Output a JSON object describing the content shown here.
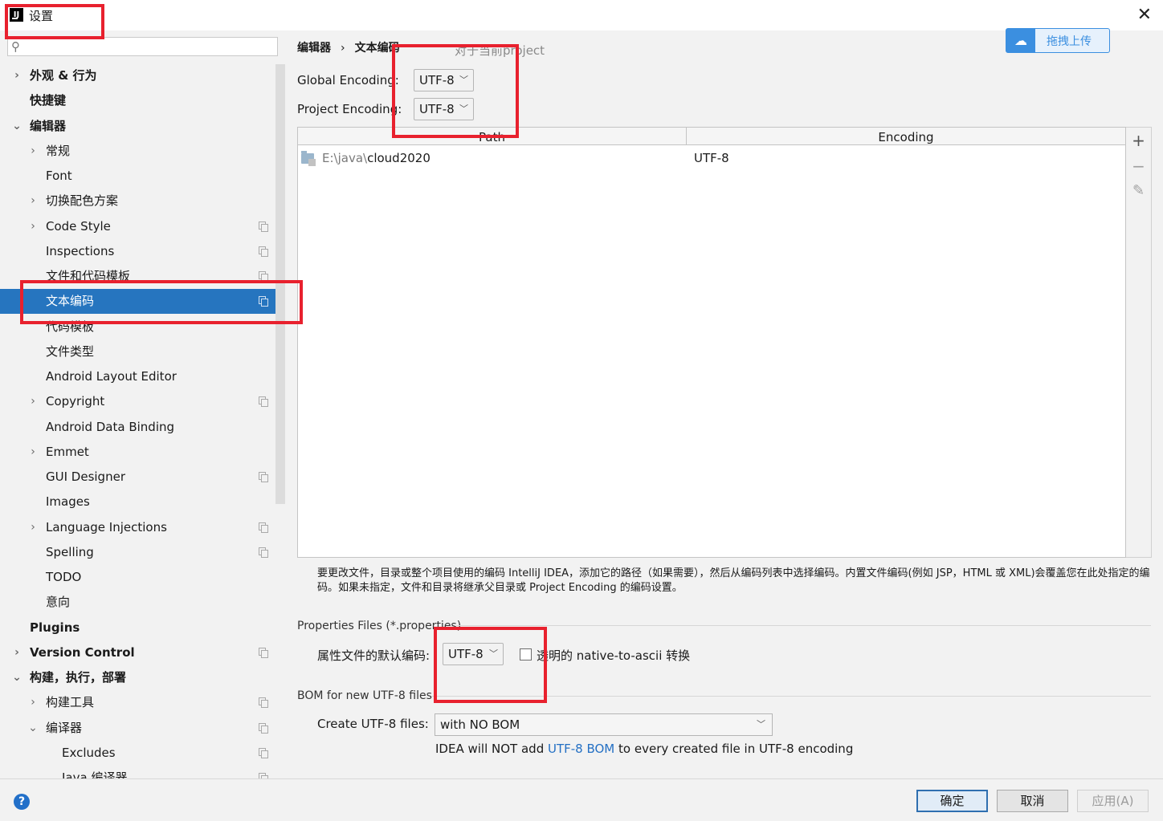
{
  "window": {
    "title": "设置",
    "app_icon": "intellij-idea-icon"
  },
  "sidebar": {
    "search_placeholder": "",
    "items": [
      {
        "label": "外观 & 行为",
        "bold": true,
        "chevron": "right",
        "copy": false
      },
      {
        "label": "快捷键",
        "bold": true,
        "chevron": "",
        "copy": false
      },
      {
        "label": "编辑器",
        "bold": true,
        "chevron": "down",
        "copy": false
      },
      {
        "label": "常规",
        "bold": false,
        "chevron": "right",
        "copy": false
      },
      {
        "label": "Font",
        "bold": false,
        "chevron": "",
        "copy": false
      },
      {
        "label": "切换配色方案",
        "bold": false,
        "chevron": "right",
        "copy": false
      },
      {
        "label": "Code Style",
        "bold": false,
        "chevron": "right",
        "copy": true
      },
      {
        "label": "Inspections",
        "bold": false,
        "chevron": "",
        "copy": true
      },
      {
        "label": "文件和代码模板",
        "bold": false,
        "chevron": "",
        "copy": true
      },
      {
        "label": "文本编码",
        "bold": false,
        "chevron": "",
        "copy": true,
        "selected": true
      },
      {
        "label": "代码模板",
        "bold": false,
        "chevron": "",
        "copy": false
      },
      {
        "label": "文件类型",
        "bold": false,
        "chevron": "",
        "copy": false
      },
      {
        "label": "Android Layout Editor",
        "bold": false,
        "chevron": "",
        "copy": false
      },
      {
        "label": "Copyright",
        "bold": false,
        "chevron": "right",
        "copy": true
      },
      {
        "label": "Android Data Binding",
        "bold": false,
        "chevron": "",
        "copy": false
      },
      {
        "label": "Emmet",
        "bold": false,
        "chevron": "right",
        "copy": false
      },
      {
        "label": "GUI Designer",
        "bold": false,
        "chevron": "",
        "copy": true
      },
      {
        "label": "Images",
        "bold": false,
        "chevron": "",
        "copy": false
      },
      {
        "label": "Language Injections",
        "bold": false,
        "chevron": "right",
        "copy": true
      },
      {
        "label": "Spelling",
        "bold": false,
        "chevron": "",
        "copy": true
      },
      {
        "label": "TODO",
        "bold": false,
        "chevron": "",
        "copy": false
      },
      {
        "label": "意向",
        "bold": false,
        "chevron": "",
        "copy": false
      },
      {
        "label": "Plugins",
        "bold": true,
        "chevron": "",
        "copy": false
      },
      {
        "label": "Version Control",
        "bold": true,
        "chevron": "right",
        "copy": true
      },
      {
        "label": "构建，执行，部署",
        "bold": true,
        "chevron": "down",
        "copy": false
      },
      {
        "label": "构建工具",
        "bold": false,
        "chevron": "right",
        "copy": true
      },
      {
        "label": "编译器",
        "bold": false,
        "chevron": "down",
        "copy": true
      },
      {
        "label": "Excludes",
        "bold": false,
        "chevron": "",
        "copy": true
      },
      {
        "label": "Java 编译器",
        "bold": false,
        "chevron": "",
        "copy": true
      }
    ]
  },
  "breadcrumb": {
    "parent": "编辑器",
    "separator": "›",
    "current": "文本编码",
    "scope": "对于当前project"
  },
  "upload": {
    "label": "拖拽上传",
    "icon": "baidu-cloud-icon"
  },
  "global_encoding": {
    "label": "Global Encoding:",
    "value": "UTF-8"
  },
  "project_encoding": {
    "label": "Project Encoding:",
    "value": "UTF-8"
  },
  "table": {
    "columns": [
      "Path",
      "Encoding"
    ],
    "rows": [
      {
        "path_prefix": "E:\\java\\",
        "path_name": "cloud2020",
        "encoding": "UTF-8"
      }
    ]
  },
  "tools": {
    "add": "+",
    "remove": "−",
    "edit": "✎"
  },
  "hint_text": "要更改文件，目录或整个项目使用的编码 IntelliJ IDEA，添加它的路径（如果需要），然后从编码列表中选择编码。内置文件编码(例如 JSP，HTML 或 XML)会覆盖您在此处指定的编码。如果未指定，文件和目录将继承父目录或 Project Encoding 的编码设置。",
  "properties": {
    "section_title": "Properties Files (*.properties)",
    "label": "属性文件的默认编码:",
    "value": "UTF-8",
    "checkbox_label": "透明的 native-to-ascii 转换",
    "checkbox_checked": false
  },
  "bom": {
    "section_title": "BOM for new UTF-8 files",
    "label": "Create UTF-8 files:",
    "value": "with NO BOM",
    "note_before": "IDEA will NOT add ",
    "note_link": "UTF-8 BOM",
    "note_after": " to every created file in UTF-8 encoding"
  },
  "footer": {
    "help": "?",
    "ok": "确定",
    "cancel": "取消",
    "apply": "应用(A)"
  },
  "colors": {
    "selection": "#2675bf",
    "annotation": "#e8212e",
    "link": "#2470c4"
  }
}
